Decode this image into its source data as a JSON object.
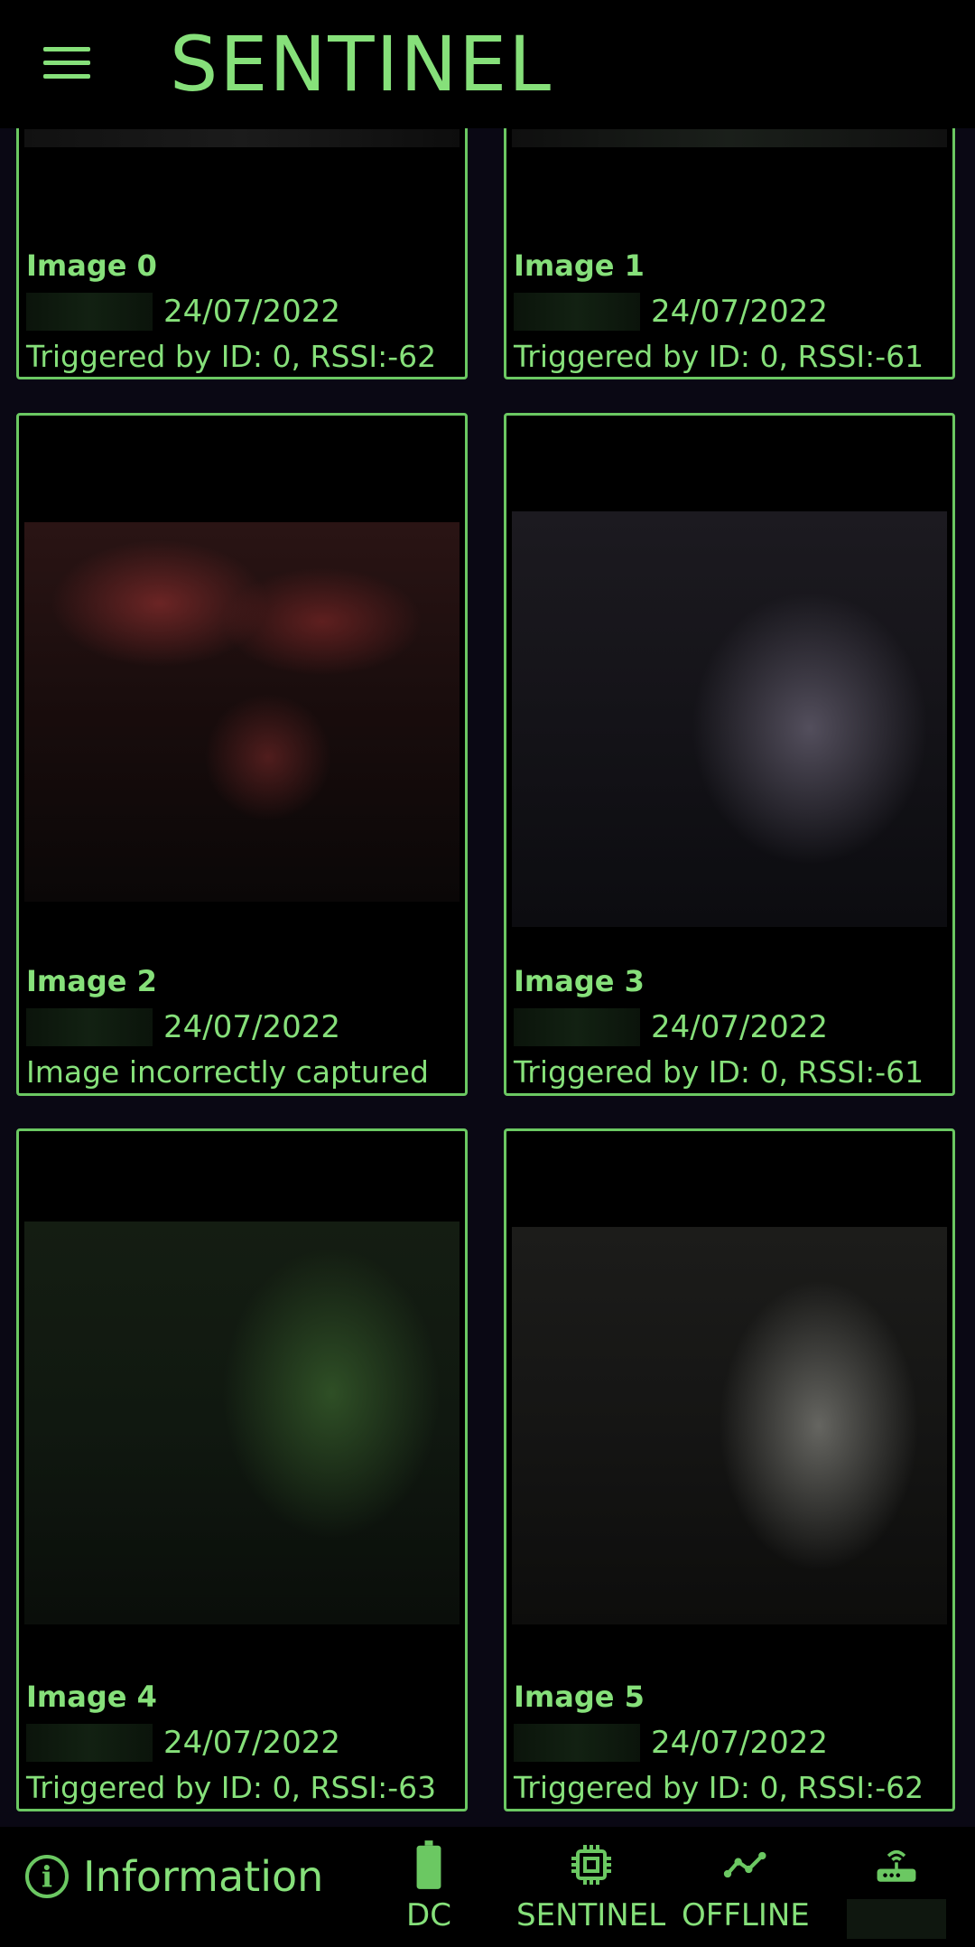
{
  "app": {
    "title": "SENTINEL"
  },
  "cards": [
    {
      "title": "Image 0",
      "date": "24/07/2022",
      "status": "Triggered by ID: 0, RSSI:-62"
    },
    {
      "title": "Image 1",
      "date": "24/07/2022",
      "status": "Triggered by ID: 0, RSSI:-61"
    },
    {
      "title": "Image 2",
      "date": "24/07/2022",
      "status": "Image incorrectly captured"
    },
    {
      "title": "Image 3",
      "date": "24/07/2022",
      "status": "Triggered by ID: 0, RSSI:-61"
    },
    {
      "title": "Image 4",
      "date": "24/07/2022",
      "status": "Triggered by ID: 0, RSSI:-63"
    },
    {
      "title": "Image 5",
      "date": "24/07/2022",
      "status": "Triggered by ID: 0, RSSI:-62"
    }
  ],
  "bottom_bar": {
    "info_label": "Information",
    "power_label": "DC",
    "device_label": "SENTINEL",
    "network_label": "OFFLINE"
  },
  "colors": {
    "accent": "#86e07a",
    "border": "#6bc862",
    "background": "#000000"
  }
}
